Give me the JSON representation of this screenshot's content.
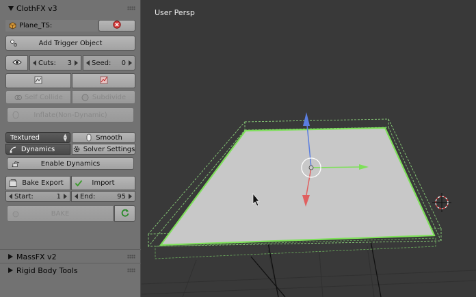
{
  "clothfx": {
    "title": "ClothFX v3",
    "object_name": "Plane_TS:",
    "add_trigger": "Add Trigger Object",
    "cuts_label": "Cuts:",
    "cuts_value": "3",
    "seed_label": "Seed:",
    "seed_value": "0",
    "self_collide": "Self Collide",
    "subdivide": "Subdivide",
    "inflate": "Inflate(Non-Dynamic)",
    "shading": "Textured",
    "smooth": "Smooth",
    "dynamics": "Dynamics",
    "solver_settings": "Solver Settings",
    "enable_dynamics": "Enable Dynamics",
    "bake_export": "Bake Export",
    "import": "Import",
    "start_label": "Start:",
    "start_value": "1",
    "end_label": "End:",
    "end_value": "95",
    "bake": "BAKE"
  },
  "collapsed_panels": [
    "MassFX v2",
    "Rigid Body Tools"
  ],
  "viewport": {
    "label": "User Persp"
  },
  "colors": {
    "panel_bg": "#727272",
    "viewport_bg": "#393939",
    "plane_fill": "#c8c8c8",
    "selection_outline": "#7ee05a",
    "axis_x": "#7ee05a",
    "axis_y": "#e06060",
    "axis_z": "#5a7ee0"
  },
  "icons": [
    "cube-icon",
    "close-icon",
    "trigger-icon",
    "eye-icon",
    "texture-icon",
    "graph-icon",
    "collide-icon",
    "subdivide-icon",
    "inflate-icon",
    "dynamics-icon",
    "gear-icon",
    "enable-icon",
    "bake-export-icon",
    "checkmark-icon",
    "refresh-icon",
    "grip-icon",
    "cursor-icon",
    "3d-cursor-icon"
  ]
}
